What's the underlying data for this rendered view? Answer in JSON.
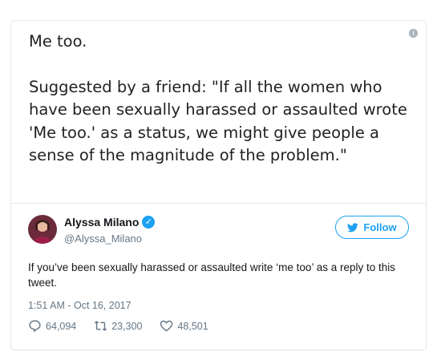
{
  "image_text": {
    "line1": "Me too.",
    "line2": "Suggested by a friend: \"If all the women who have been sexually harassed or assaulted wrote 'Me too.' as a status, we might give people a sense of the magnitude of the problem.\""
  },
  "author": {
    "name": "Alyssa Milano",
    "handle": "@Alyssa_Milano",
    "verified": true
  },
  "follow_label": "Follow",
  "tweet_text": "If you’ve been sexually harassed or assaulted write ‘me too’ as a reply to this tweet.",
  "timestamp": "1:51 AM - Oct 16, 2017",
  "stats": {
    "replies": "64,094",
    "retweets": "23,300",
    "likes": "48,501"
  },
  "colors": {
    "accent": "#1da1f2",
    "secondary_text": "#657786"
  }
}
